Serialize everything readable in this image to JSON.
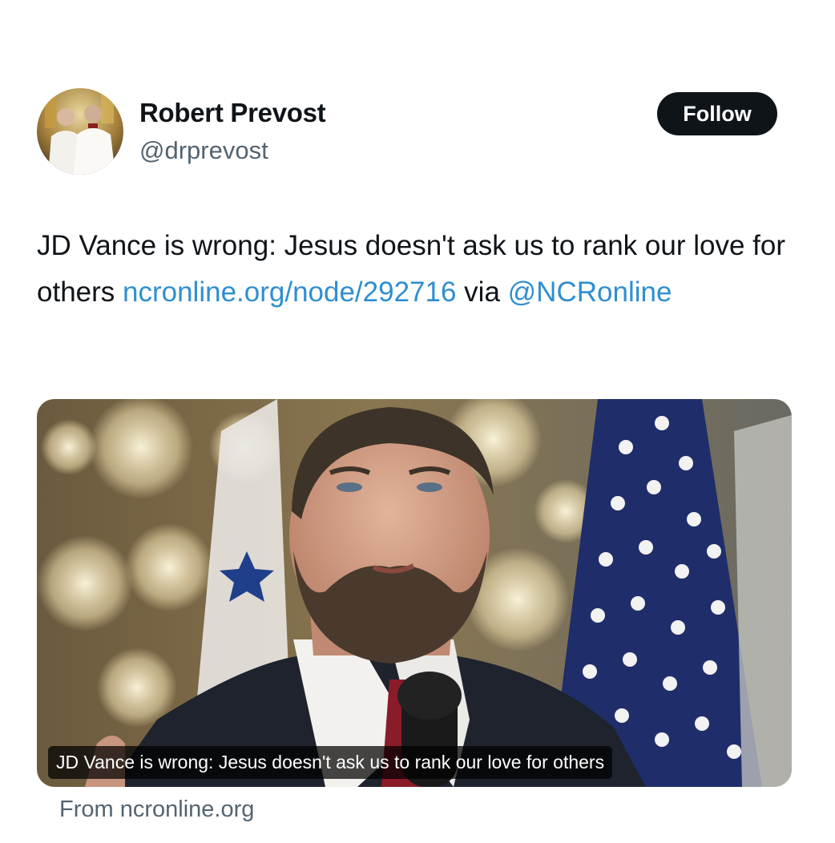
{
  "author": {
    "display_name": "Robert Prevost",
    "handle": "@drprevost",
    "avatar_icon": "profile-photo"
  },
  "follow_label": "Follow",
  "tweet": {
    "text_before_link": "JD Vance is wrong: Jesus doesn't ask us to rank our love for others ",
    "link": "ncronline.org/node/292716",
    "text_after_link": " via ",
    "mention": "@NCRonline"
  },
  "card": {
    "caption": "JD Vance is wrong: Jesus doesn't ask us to rank our love for others",
    "source": "From ncronline.org"
  },
  "colors": {
    "link": "#2f8fcf",
    "follow_bg": "#0f1419",
    "secondary_text": "#536471"
  }
}
